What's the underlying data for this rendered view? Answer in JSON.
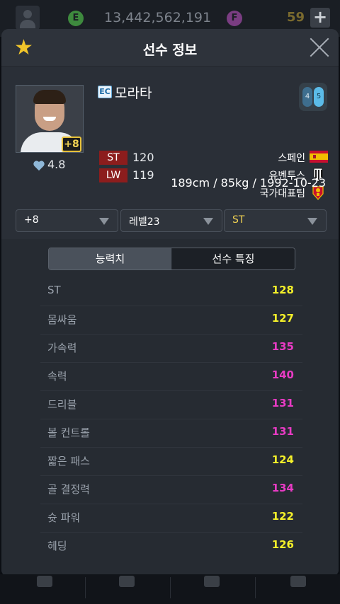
{
  "topbar": {
    "ep_coin": "E",
    "ep_amount": "13,442,562,191",
    "fc_coin": "F",
    "fc_amount": "59",
    "add_label": "+"
  },
  "header": {
    "title": "선수 정보"
  },
  "player": {
    "name": "모라타",
    "season_badge": "EC",
    "enhance_badge": "+8",
    "rating": "4.8",
    "positions": [
      {
        "pos": "ST",
        "ovr": "120"
      },
      {
        "pos": "LW",
        "ovr": "119"
      }
    ],
    "foot_left": "4",
    "foot_right": "5",
    "nationality": "스페인",
    "club": "유벤투스",
    "national_team": "국가대표팀",
    "physical": "189cm / 85kg / 1992-10-23"
  },
  "selectors": {
    "enhance": "+8",
    "level": "레벨23",
    "position": "ST"
  },
  "tabs": {
    "active": "능력치",
    "inactive": "선수 특징"
  },
  "stats": [
    {
      "name": "ST",
      "value": "128",
      "color": "#f4f02a"
    },
    {
      "name": "몸싸움",
      "value": "127",
      "color": "#f4f02a"
    },
    {
      "name": "가속력",
      "value": "135",
      "color": "#e83bc4"
    },
    {
      "name": "속력",
      "value": "140",
      "color": "#e83bc4"
    },
    {
      "name": "드리블",
      "value": "131",
      "color": "#e83bc4"
    },
    {
      "name": "볼 컨트롤",
      "value": "131",
      "color": "#e83bc4"
    },
    {
      "name": "짧은 패스",
      "value": "124",
      "color": "#f4f02a"
    },
    {
      "name": "골 결정력",
      "value": "134",
      "color": "#e83bc4"
    },
    {
      "name": "슛 파워",
      "value": "122",
      "color": "#f4f02a"
    },
    {
      "name": "헤딩",
      "value": "126",
      "color": "#f4f02a"
    }
  ]
}
